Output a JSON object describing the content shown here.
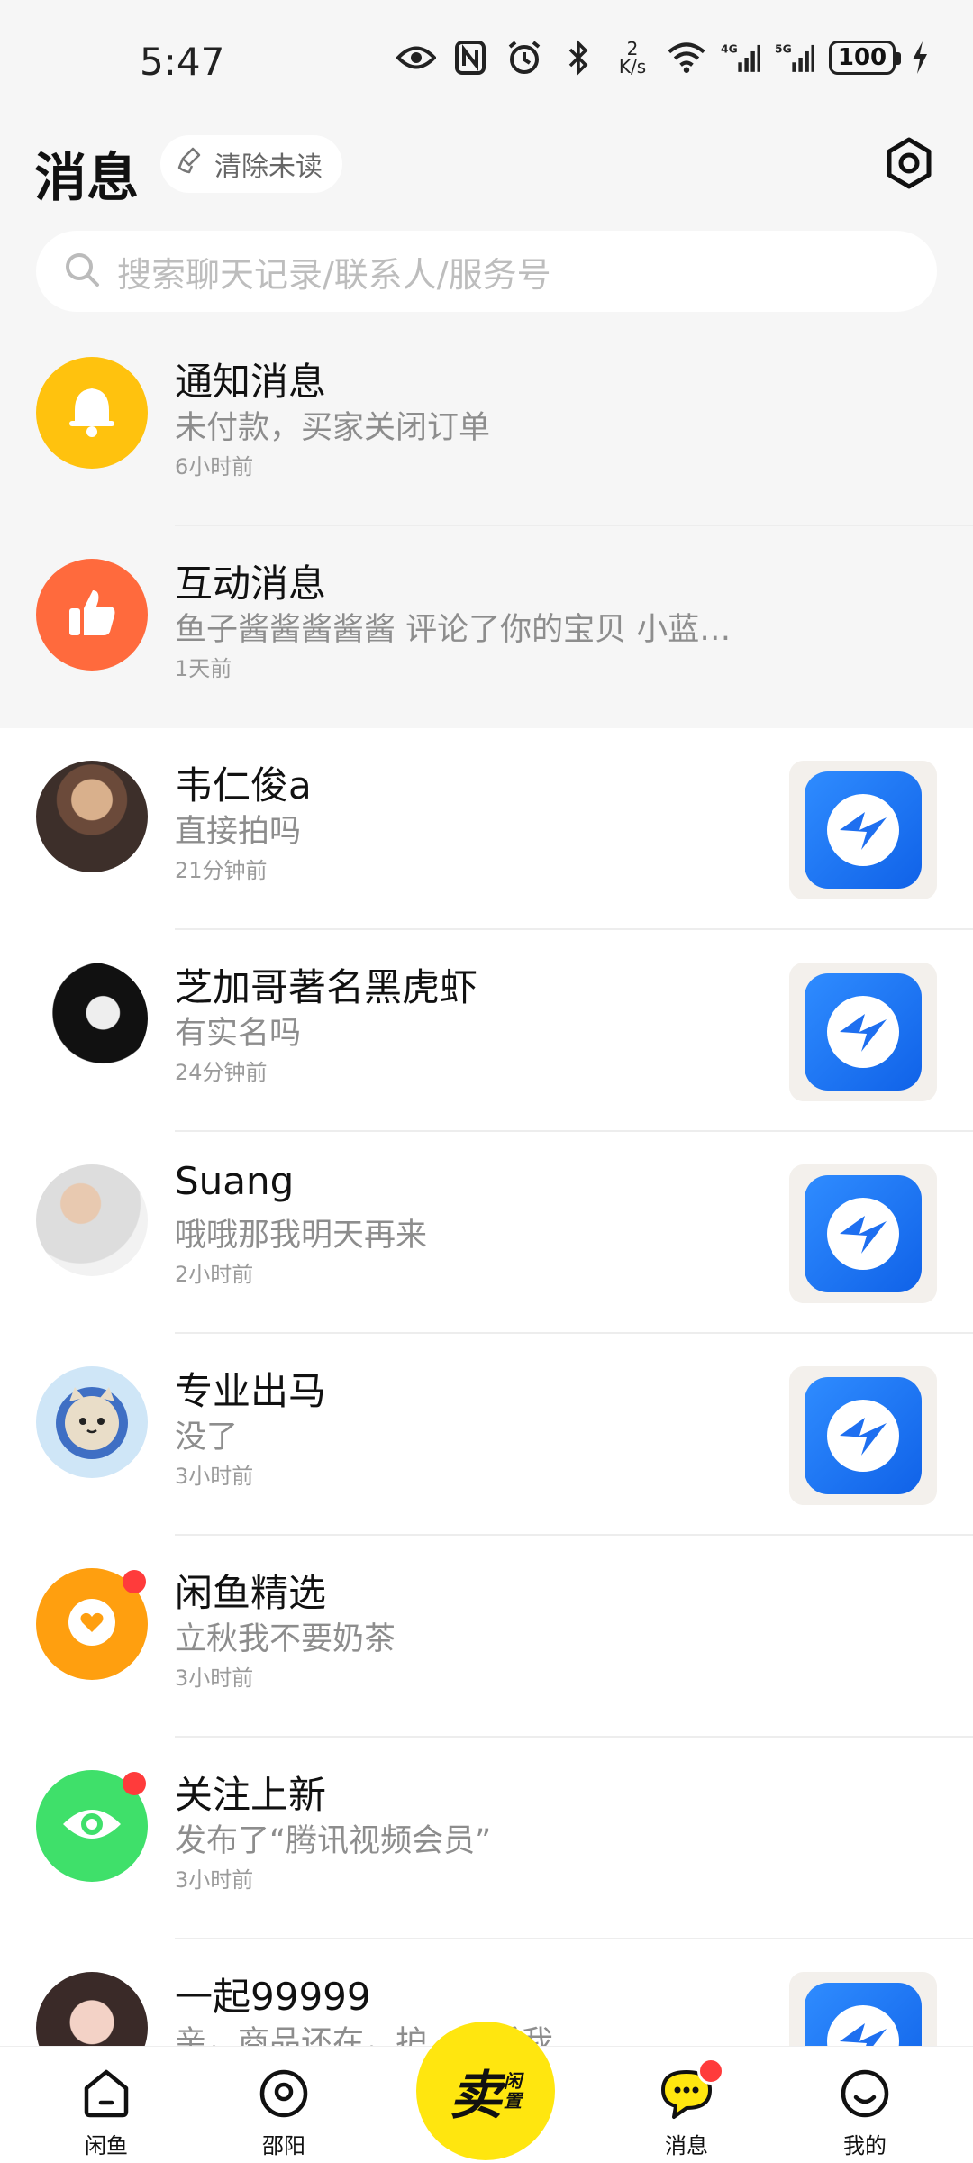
{
  "status_bar": {
    "time": "5:47",
    "net_speed_value": "2",
    "net_speed_unit": "K/s",
    "battery": "100",
    "icons": [
      "eye-icon",
      "nfc-icon",
      "alarm-icon",
      "bluetooth-icon",
      "wifi-icon",
      "signal-4g-icon",
      "signal-5g-icon",
      "charging-icon"
    ]
  },
  "header": {
    "title": "消息",
    "clear_unread": "清除未读"
  },
  "search": {
    "placeholder": "搜索聊天记录/联系人/服务号"
  },
  "system_messages": [
    {
      "name": "通知消息",
      "preview": "未付款，买家关闭订单",
      "time": "6小时前",
      "icon": "bell-icon",
      "color": "#ffc20e"
    },
    {
      "name": "互动消息",
      "preview": "鱼子酱酱酱酱酱 评论了你的宝贝 小蓝…",
      "time": "1天前",
      "icon": "thumbs-up-icon",
      "color": "#ff6a3d"
    }
  ],
  "chats": [
    {
      "name": "韦仁俊a",
      "preview": "直接拍吗",
      "time": "21分钟前"
    },
    {
      "name": "芝加哥著名黑虎虾",
      "preview": "有实名吗",
      "time": "24分钟前"
    },
    {
      "name": "Suang",
      "preview": "哦哦那我明天再来",
      "time": "2小时前"
    },
    {
      "name": "专业出马",
      "preview": "没了",
      "time": "3小时前"
    },
    {
      "name": "闲鱼精选",
      "preview": "立秋我不要奶茶",
      "time": "3小时前"
    },
    {
      "name": "关注上新",
      "preview": "发布了“腾讯视频会员”",
      "time": "3小时前"
    },
    {
      "name": "一起99999",
      "preview": "亲，商品还在，护…联系我",
      "time": ""
    }
  ],
  "bottom_nav": {
    "items": [
      "闲鱼",
      "邵阳",
      "消息",
      "我的"
    ],
    "sell_main": "卖",
    "sell_sub_1": "闲",
    "sell_sub_2": "置"
  },
  "colors": {
    "accent_yellow": "#ffe60f",
    "badge_red": "#ff3b3b",
    "thumb_blue": "#1e6ff0"
  }
}
